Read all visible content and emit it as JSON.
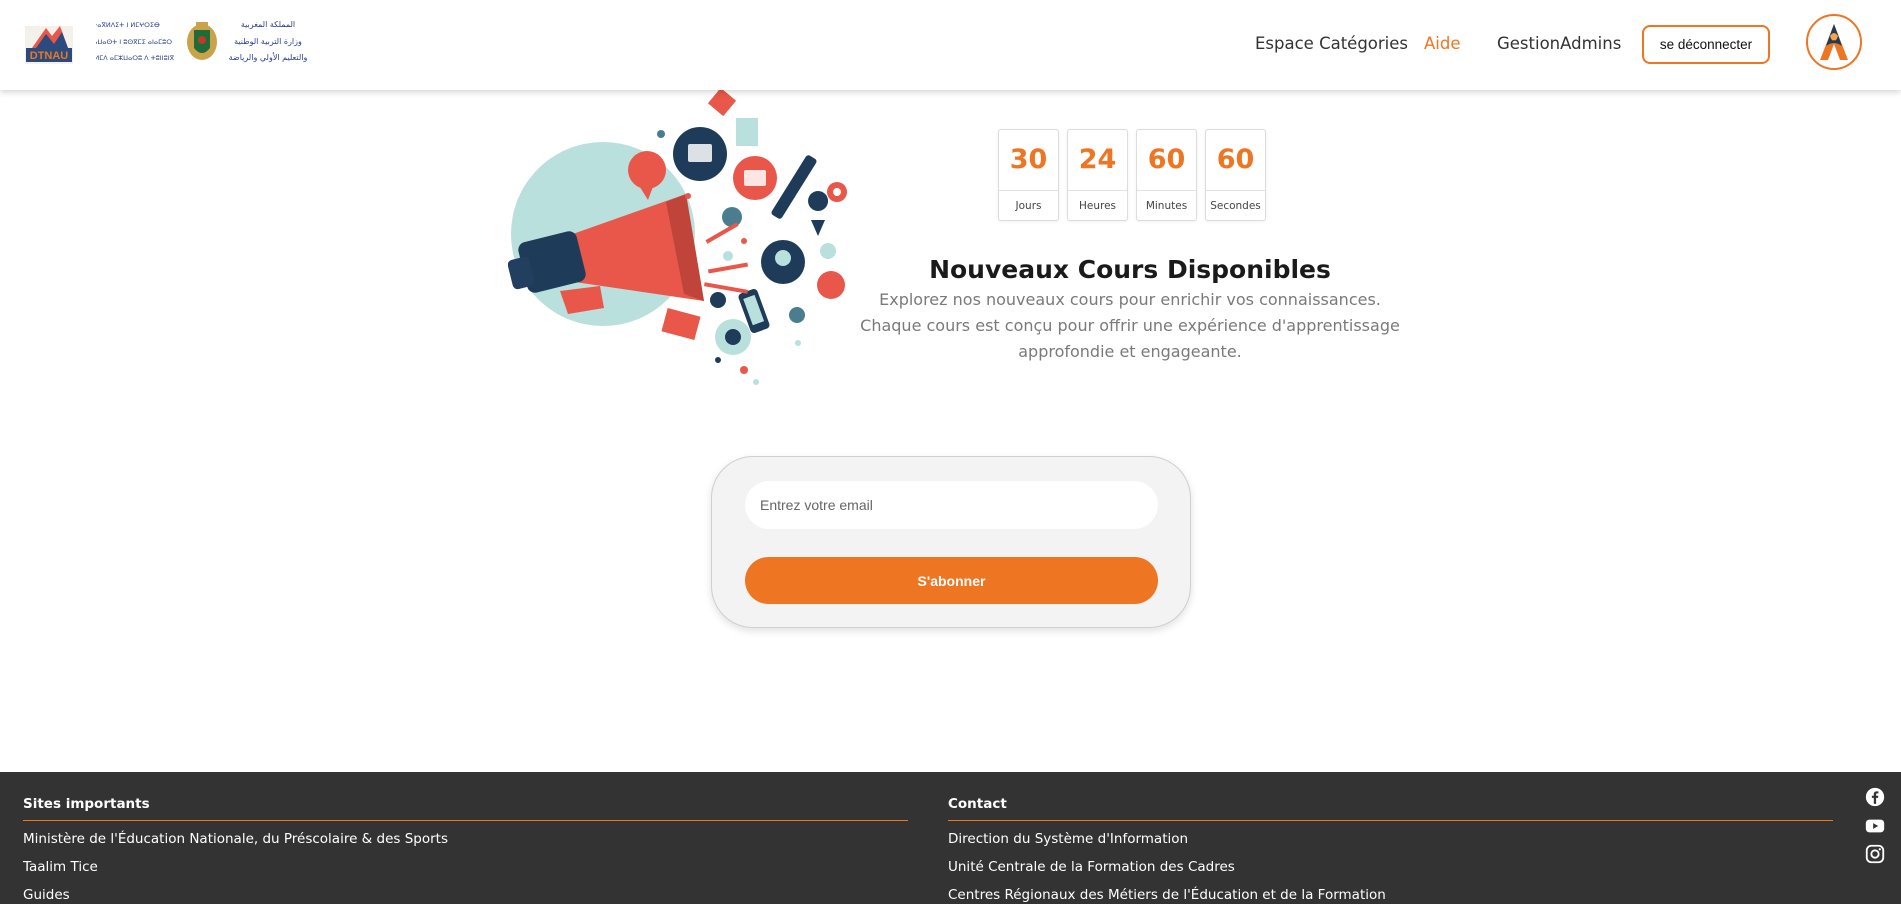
{
  "header": {
    "nav": [
      {
        "label": "Espace Catégories",
        "active": false
      },
      {
        "label": "Aide",
        "active": true
      },
      {
        "label": "GestionAdmins",
        "active": false
      }
    ],
    "logout_label": "se déconnecter",
    "logo_texts": {
      "dtnau": "DTNAU",
      "ministry_arabic": [
        "المملكة المغربية",
        "وزارة التربية الوطنية",
        "والتعليم الأولي والرياضة"
      ],
      "ministry_tifinagh": [
        "ⵜⴰⴳⵍⴷⵉⵜ ⵏ ⵍⵎⵖⵔⵉⴱ",
        "ⵜⴰⵎⴰⵡⴰⵙⵜ ⵏ ⵓⵙⴳⵎⵉ ⴰⵏⴰⵎⵓⵔ",
        "ⴷ ⵓⵙⵍⵎⴷ ⴰⵎⵣⵡⴰⵔⵓ ⴷ ⵜⵓⵏⵏⵓⵏⴳ"
      ]
    }
  },
  "countdown": [
    {
      "value": "30",
      "label": "Jours"
    },
    {
      "value": "24",
      "label": "Heures"
    },
    {
      "value": "60",
      "label": "Minutes"
    },
    {
      "value": "60",
      "label": "Secondes"
    }
  ],
  "hero": {
    "title": "Nouveaux Cours Disponibles",
    "description": "Explorez nos nouveaux cours pour enrichir vos connaissances. Chaque cours est conçu pour offrir une expérience d'apprentissage approfondie et engageante."
  },
  "subscribe": {
    "email_value": "",
    "email_placeholder": "Entrez votre email",
    "button_label": "S'abonner"
  },
  "footer": {
    "sites_title": "Sites importants",
    "sites": [
      "Ministère de l'Éducation Nationale, du Préscolaire & des Sports",
      "Taalim Tice",
      "Guides"
    ],
    "contact_title": "Contact",
    "contacts": [
      "Direction du Système d'Information",
      "Unité Centrale de la Formation des Cadres",
      "Centres Régionaux des Métiers de l'Éducation et de la Formation"
    ],
    "social_icons": [
      "facebook-icon",
      "youtube-icon",
      "instagram-icon"
    ]
  },
  "colors": {
    "accent": "#ee7623",
    "footer_bg": "#333333",
    "megaphone_red": "#e8574a",
    "navy": "#1f3b5a",
    "mint": "#b9e0dc"
  }
}
